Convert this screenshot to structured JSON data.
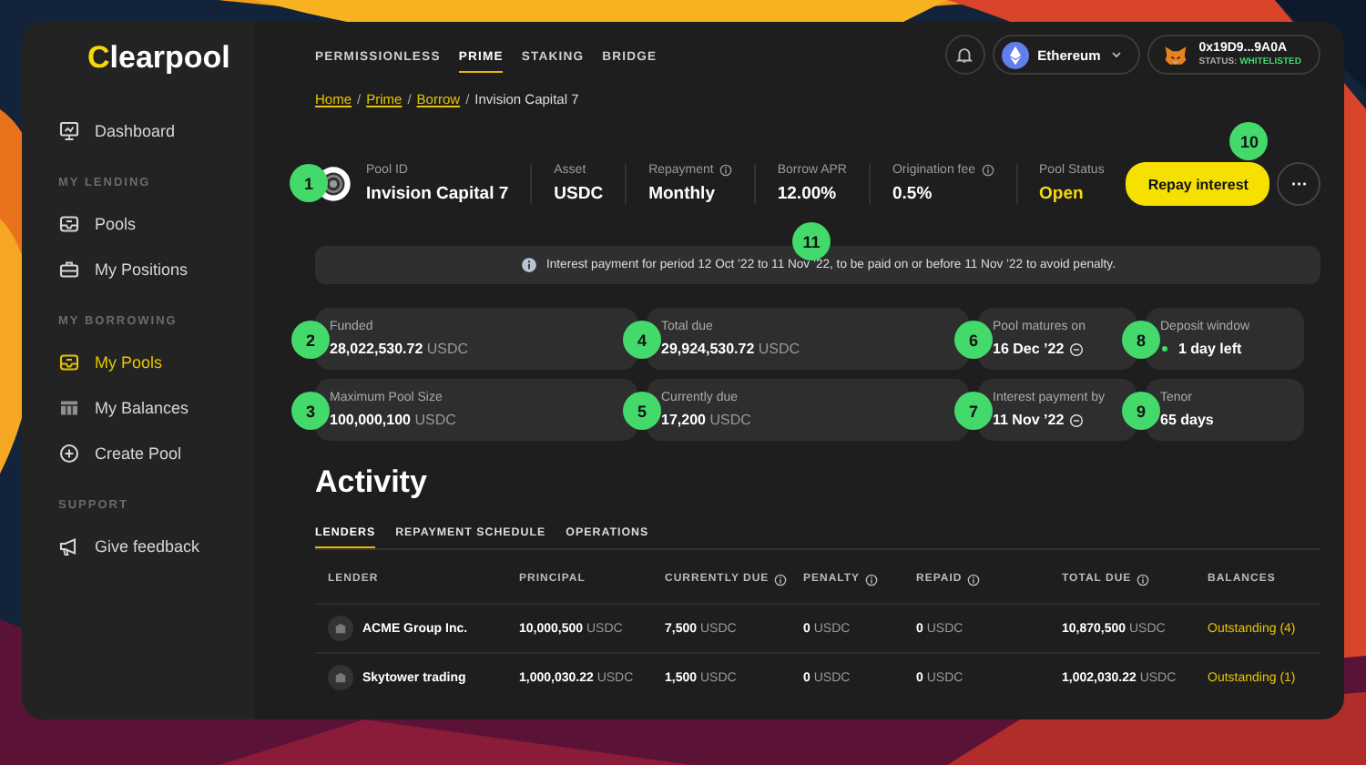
{
  "sidebar": {
    "logo": "Clearpool",
    "sections": [
      {
        "items": [
          {
            "label": "Dashboard",
            "selected": false
          }
        ]
      },
      {
        "heading": "MY LENDING",
        "items": [
          {
            "label": "Pools",
            "selected": false
          },
          {
            "label": "My Positions",
            "selected": false
          }
        ]
      },
      {
        "heading": "MY BORROWING",
        "items": [
          {
            "label": "My Pools",
            "selected": true
          },
          {
            "label": "My Balances",
            "selected": false
          },
          {
            "label": "Create Pool",
            "selected": false
          }
        ]
      },
      {
        "heading": "SUPPORT",
        "items": [
          {
            "label": "Give feedback",
            "selected": false
          }
        ]
      }
    ]
  },
  "topbar": {
    "tabs": [
      {
        "label": "PERMISSIONLESS",
        "selected": false
      },
      {
        "label": "PRIME",
        "selected": true
      },
      {
        "label": "STAKING",
        "selected": false
      },
      {
        "label": "BRIDGE",
        "selected": false
      }
    ],
    "network": "Ethereum",
    "wallet": {
      "address": "0x19D9...9A0A",
      "status_label": "STATUS:",
      "status": "WHITELISTED"
    }
  },
  "breadcrumb": {
    "separator": "/",
    "items": [
      {
        "label": "Home",
        "link": true
      },
      {
        "label": "Prime",
        "link": true
      },
      {
        "label": "Borrow",
        "link": true
      },
      {
        "label": "Invision Capital 7",
        "link": false
      }
    ]
  },
  "pool": {
    "marker": "1",
    "fields": [
      {
        "label": "Pool ID",
        "value": "Invision Capital 7",
        "info": false,
        "accent": false
      },
      {
        "label": "Asset",
        "value": "USDC",
        "info": false,
        "accent": false
      },
      {
        "label": "Repayment",
        "value": "Monthly",
        "info": true,
        "accent": false
      },
      {
        "label": "Borrow APR",
        "value": "12.00%",
        "info": false,
        "accent": false
      },
      {
        "label": "Origination fee",
        "value": "0.5%",
        "info": true,
        "accent": false
      },
      {
        "label": "Pool Status",
        "value": "Open",
        "info": false,
        "accent": true
      }
    ],
    "repay_button": {
      "label": "Repay interest",
      "marker": "10"
    },
    "more_button": "···"
  },
  "notice": {
    "text": "Interest payment for period 12 Oct ’22 to 11 Nov ’22, to be paid on or before 11 Nov ’22 to avoid penalty.",
    "marker": "11"
  },
  "stats": [
    {
      "marker": "2",
      "label": "Funded",
      "value": "28,022,530.72",
      "unit": "USDC",
      "kind": "amount"
    },
    {
      "marker": "4",
      "label": "Total due",
      "value": "29,924,530.72",
      "unit": "USDC",
      "kind": "amount"
    },
    {
      "marker": "6",
      "label": "Pool matures on",
      "value": "16 Dec ’22",
      "kind": "date"
    },
    {
      "marker": "8",
      "label": "Deposit window",
      "value": "1 day left",
      "kind": "countdown"
    },
    {
      "marker": "3",
      "label": "Maximum Pool Size",
      "value": "100,000,100",
      "unit": "USDC",
      "kind": "amount"
    },
    {
      "marker": "5",
      "label": "Currently due",
      "value": "17,200",
      "unit": "USDC",
      "kind": "amount"
    },
    {
      "marker": "7",
      "label": "Interest payment by",
      "value": "11 Nov ’22",
      "kind": "date"
    },
    {
      "marker": "9",
      "label": "Tenor",
      "value": "65 days",
      "kind": "plain"
    }
  ],
  "activity": {
    "title": "Activity",
    "tabs": [
      {
        "label": "LENDERS",
        "selected": true
      },
      {
        "label": "REPAYMENT SCHEDULE",
        "selected": false
      },
      {
        "label": "OPERATIONS",
        "selected": false
      }
    ],
    "columns": [
      {
        "label": "LENDER",
        "info": false
      },
      {
        "label": "PRINCIPAL",
        "info": false
      },
      {
        "label": "CURRENTLY DUE",
        "info": true
      },
      {
        "label": "PENALTY",
        "info": true
      },
      {
        "label": "REPAID",
        "info": true
      },
      {
        "label": "TOTAL DUE",
        "info": true
      },
      {
        "label": "BALANCES",
        "info": false
      }
    ],
    "rows": [
      {
        "lender": "ACME Group Inc.",
        "amounts": [
          {
            "value": "10,000,500",
            "unit": "USDC"
          },
          {
            "value": "7,500",
            "unit": "USDC"
          },
          {
            "value": "0",
            "unit": "USDC"
          },
          {
            "value": "0",
            "unit": "USDC"
          },
          {
            "value": "10,870,500",
            "unit": "USDC"
          }
        ],
        "balance": "Outstanding (4)"
      },
      {
        "lender": "Skytower trading",
        "amounts": [
          {
            "value": "1,000,030.22",
            "unit": "USDC"
          },
          {
            "value": "1,500",
            "unit": "USDC"
          },
          {
            "value": "0",
            "unit": "USDC"
          },
          {
            "value": "0",
            "unit": "USDC"
          },
          {
            "value": "1,002,030.22",
            "unit": "USDC"
          }
        ],
        "balance": "Outstanding (1)"
      }
    ]
  }
}
